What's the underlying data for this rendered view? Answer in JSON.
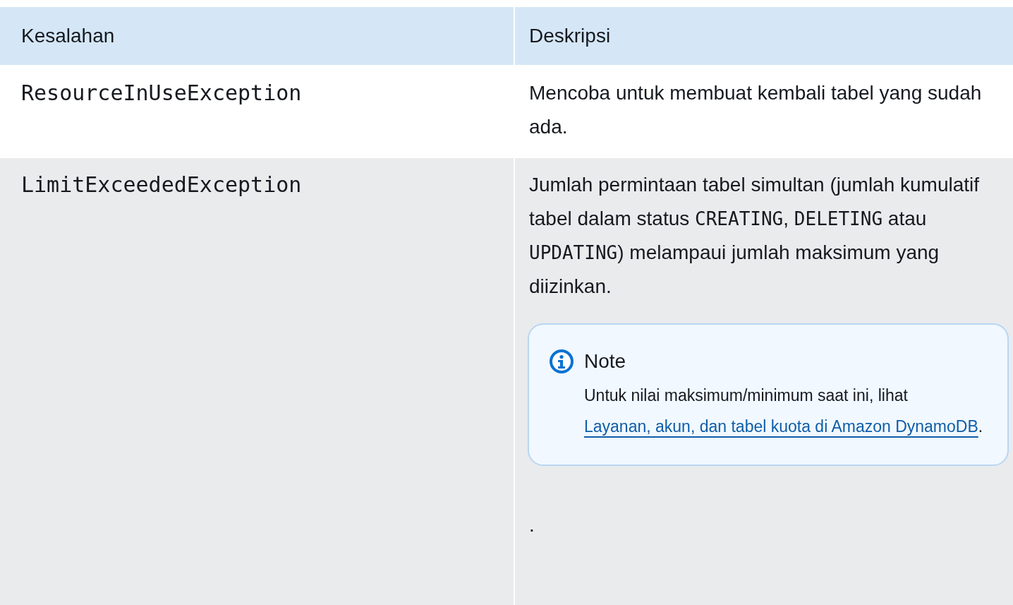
{
  "table": {
    "columns": [
      "Kesalahan",
      "Deskripsi"
    ],
    "rows": [
      {
        "error": "ResourceInUseException",
        "description": [
          {
            "kind": "text",
            "text": "Mencoba untuk membuat kembali tabel yang sudah ada."
          }
        ]
      },
      {
        "error": "LimitExceededException",
        "description": [
          {
            "kind": "text",
            "text": "Jumlah permintaan tabel simultan (jumlah kumulatif tabel dalam status "
          },
          {
            "kind": "code",
            "text": "CREATING"
          },
          {
            "kind": "text",
            "text": ", "
          },
          {
            "kind": "code",
            "text": "DELETING"
          },
          {
            "kind": "text",
            "text": " atau "
          },
          {
            "kind": "code",
            "text": "UPDATING"
          },
          {
            "kind": "text",
            "text": ") melampaui jumlah maksimum yang diizinkan."
          }
        ],
        "note": {
          "title": "Note",
          "body": [
            {
              "kind": "text",
              "text": "Untuk nilai maksimum/minimum saat ini, lihat "
            },
            {
              "kind": "link",
              "text": "Layanan, akun, dan tabel kuota di Amazon DynamoDB"
            },
            {
              "kind": "text",
              "text": "."
            }
          ]
        },
        "trailing": "."
      }
    ]
  }
}
